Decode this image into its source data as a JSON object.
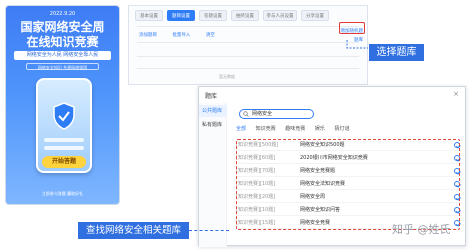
{
  "poster": {
    "date": "2022.9.20",
    "title_line1": "国家网络安全周",
    "title_line2": "在线知识竞赛",
    "subtitle": "网络安全为人民 网络安全靠人民",
    "tagline": "网络安全知识 共建网络强国",
    "start_button": "开始答题",
    "footer": "立即参与答题 赢取好礼"
  },
  "panel": {
    "tabs": [
      {
        "label": "基本设置"
      },
      {
        "label": "题目设置"
      },
      {
        "label": "答题设置"
      },
      {
        "label": "抽奖设置"
      },
      {
        "label": "参与人员设置"
      },
      {
        "label": "分享设置"
      }
    ],
    "active_tab": 1,
    "toolbar": {
      "add_question": "添加题目",
      "batch_import": "批量导入",
      "clear": "清空"
    },
    "right_buttons": {
      "add_random": "增加随机题",
      "bank": "题库"
    },
    "empty_text": "暂无数据"
  },
  "callouts": {
    "select_bank": "选择题库",
    "find_bank": "查找网络安全相关题库"
  },
  "dialog": {
    "title": "题库",
    "close_icon": "close-icon",
    "sidebar": [
      {
        "label": "公共题库"
      },
      {
        "label": "私有题库"
      }
    ],
    "search_value": "网络安全",
    "categories": [
      "全部",
      "知识竞赛",
      "趣味竞赛",
      "娱乐",
      "猜灯谜"
    ],
    "rows": [
      {
        "tag": "[知识竞赛]",
        "count": "[500题]",
        "name": "网络安全知识500题"
      },
      {
        "tag": "[知识竞赛]",
        "count": "[60题]",
        "name": "2020银川市网络安全知识竞赛"
      },
      {
        "tag": "[知识竞赛]",
        "count": "[70题]",
        "name": "网络安全竞赛题"
      },
      {
        "tag": "[知识竞赛]",
        "count": "[10题]",
        "name": "网络安全法知识竞赛"
      },
      {
        "tag": "[知识竞赛]",
        "count": "[20题]",
        "name": "网络安全周"
      },
      {
        "tag": "[知识竞赛]",
        "count": "[10题]",
        "name": "网络安全知识问答"
      },
      {
        "tag": "[知识竞赛]",
        "count": "[15题]",
        "name": "网络安全竞赛"
      }
    ]
  },
  "watermark": "知乎 @姓氏"
}
